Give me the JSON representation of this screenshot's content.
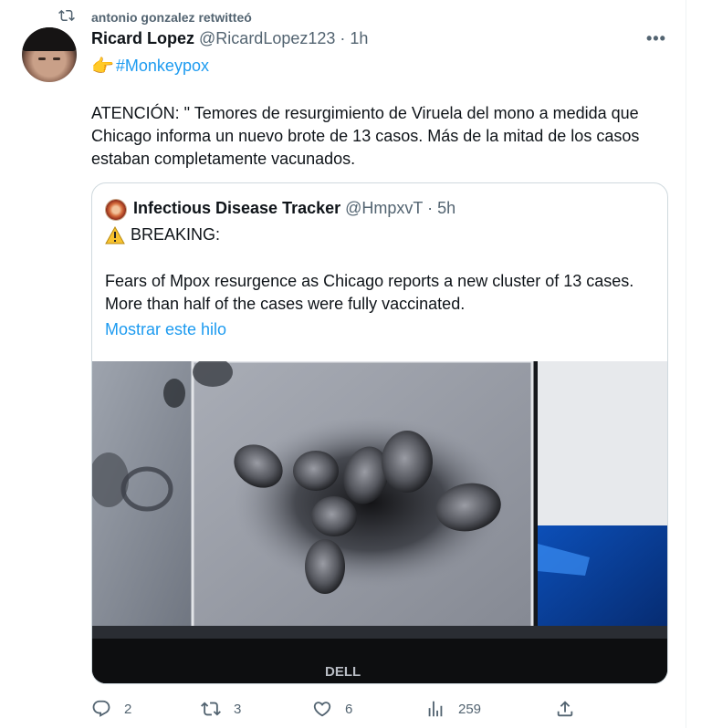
{
  "retweet": {
    "icon": "retweet-icon",
    "text": "antonio gonzalez retwitteó"
  },
  "tweet": {
    "author_name": "Ricard Lopez",
    "author_handle": "@RicardLopez123 · 1h",
    "more_icon": "more-icon",
    "more_label": "•••",
    "hashtag_emoji": "👉",
    "hashtag": "#Monkeypox",
    "text": "ATENCIÓN: \" Temores de resurgimiento de Viruela del mono a medida que Chicago informa un nuevo brote de 13 casos. Más de la mitad de los casos estaban completamente vacunados."
  },
  "quoted_tweet": {
    "author_name": "Infectious Disease Tracker",
    "author_handle": "@HmpxvT · 5h",
    "breaking_icon": "warning-icon",
    "breaking_label": "BREAKING:",
    "text": "Fears of Mpox resurgence as Chicago reports a new cluster of 13 cases. More than half of the cases were fully vaccinated.",
    "show_thread": "Mostrar este hilo",
    "image_brand": "DELL"
  },
  "actions": {
    "reply_count": "2",
    "retweet_count": "3",
    "like_count": "6",
    "views_count": "259"
  },
  "colors": {
    "accent": "#1d9bf0",
    "secondary_text": "#536471",
    "border": "#cfd9de"
  }
}
